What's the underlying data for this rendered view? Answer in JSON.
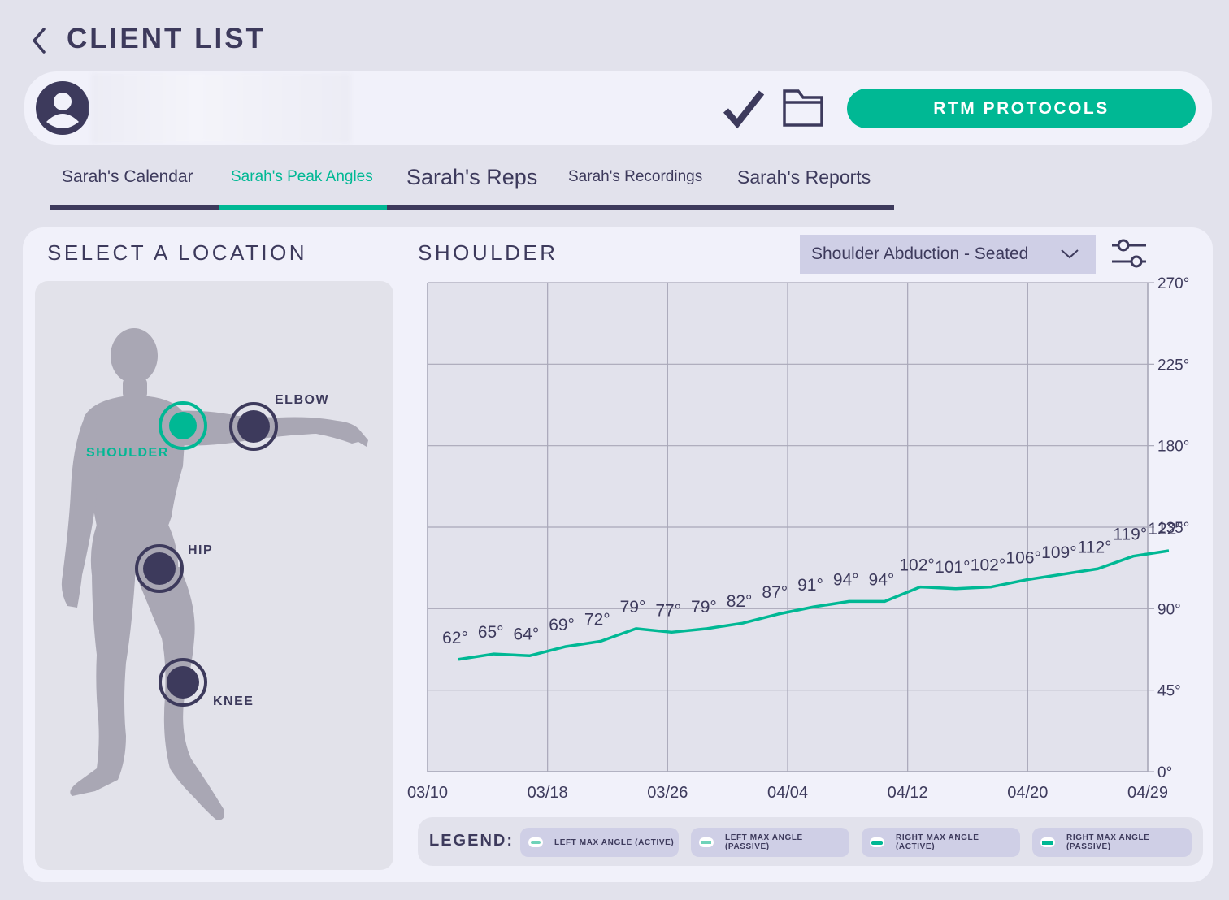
{
  "header": {
    "title": "CLIENT LIST"
  },
  "client_bar": {
    "rtm_button": "RTM PROTOCOLS"
  },
  "tabs": [
    {
      "label": "Sarah's Calendar"
    },
    {
      "label": "Sarah's Peak Angles"
    },
    {
      "label": "Sarah's Reps"
    },
    {
      "label": "Sarah's Recordings"
    },
    {
      "label": "Sarah's Reports"
    }
  ],
  "location_panel": {
    "title": "SELECT A LOCATION",
    "joints": {
      "shoulder": "SHOULDER",
      "elbow": "ELBOW",
      "hip": "HIP",
      "knee": "KNEE"
    },
    "selected": "shoulder"
  },
  "chart_panel": {
    "title": "SHOULDER",
    "exercise_select": "Shoulder Abduction - Seated"
  },
  "legend": {
    "title": "LEGEND:",
    "items": [
      "LEFT MAX ANGLE (ACTIVE)",
      "LEFT MAX ANGLE (PASSIVE)",
      "RIGHT MAX ANGLE (ACTIVE)",
      "RIGHT MAX ANGLE (PASSIVE)"
    ]
  },
  "colors": {
    "accent": "#00b894",
    "text": "#3d3a5c",
    "background": "#e2e2ec",
    "panel": "#f1f1fa"
  },
  "chart_data": {
    "type": "line",
    "x_ticks": [
      "03/10",
      "03/18",
      "03/26",
      "04/04",
      "04/12",
      "04/20",
      "04/29"
    ],
    "y_ticks": [
      "0°",
      "45°",
      "90°",
      "135°",
      "180°",
      "225°",
      "270°"
    ],
    "ylim": [
      0,
      270
    ],
    "grid": true,
    "series": [
      {
        "color": "#00b894",
        "values": [
          62,
          65,
          64,
          69,
          72,
          79,
          77,
          79,
          82,
          87,
          91,
          94,
          94,
          102,
          101,
          102,
          106,
          109,
          112,
          119,
          122
        ],
        "labels": [
          "62°",
          "65°",
          "64°",
          "69°",
          "72°",
          "79°",
          "77°",
          "79°",
          "82°",
          "87°",
          "91°",
          "94°",
          "94°",
          "102°",
          "101°",
          "102°",
          "106°",
          "109°",
          "112°",
          "119°",
          "122°"
        ]
      }
    ]
  }
}
